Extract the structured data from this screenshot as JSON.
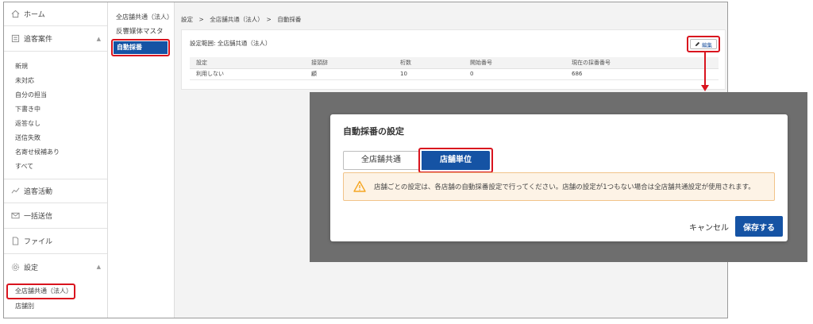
{
  "sidebar": {
    "home": "ホーム",
    "followup": "追客案件",
    "followup_items": [
      "新規",
      "未対応",
      "自分の担当",
      "下書き中",
      "返答なし",
      "送信失敗",
      "名寄せ候補あり",
      "すべて"
    ],
    "activity": "追客活動",
    "bulk_send": "一括送信",
    "file": "ファイル",
    "settings": "設定",
    "settings_items": [
      "全店舗共通（法人）",
      "店舗別"
    ]
  },
  "col2": {
    "items": [
      "全店舗共通（法人）",
      "反響媒体マスタ",
      "自動採番"
    ]
  },
  "main": {
    "breadcrumb": "設定　>　全店舗共通（法人）　>　自動採番",
    "scope_label": "設定範囲: 全店舗共通（法人）",
    "edit_label": "編集",
    "table": {
      "headers": [
        "設定",
        "接頭辞",
        "桁数",
        "開始番号",
        "現在の採番番号"
      ],
      "rows": [
        [
          "利用しない",
          "顧",
          "10",
          "0",
          "686"
        ]
      ]
    }
  },
  "modal": {
    "title": "自動採番の設定",
    "tab_common": "全店舗共通",
    "tab_store": "店舗単位",
    "alert_text": "店舗ごとの設定は、各店舗の自動採番設定で行ってください。店舗の設定が1つもない場合は全店舗共通設定が使用されます。",
    "cancel": "キャンセル",
    "save": "保存する"
  },
  "colors": {
    "accent": "#1553a4",
    "highlight": "#d9141e",
    "warning": "#f5a623"
  }
}
